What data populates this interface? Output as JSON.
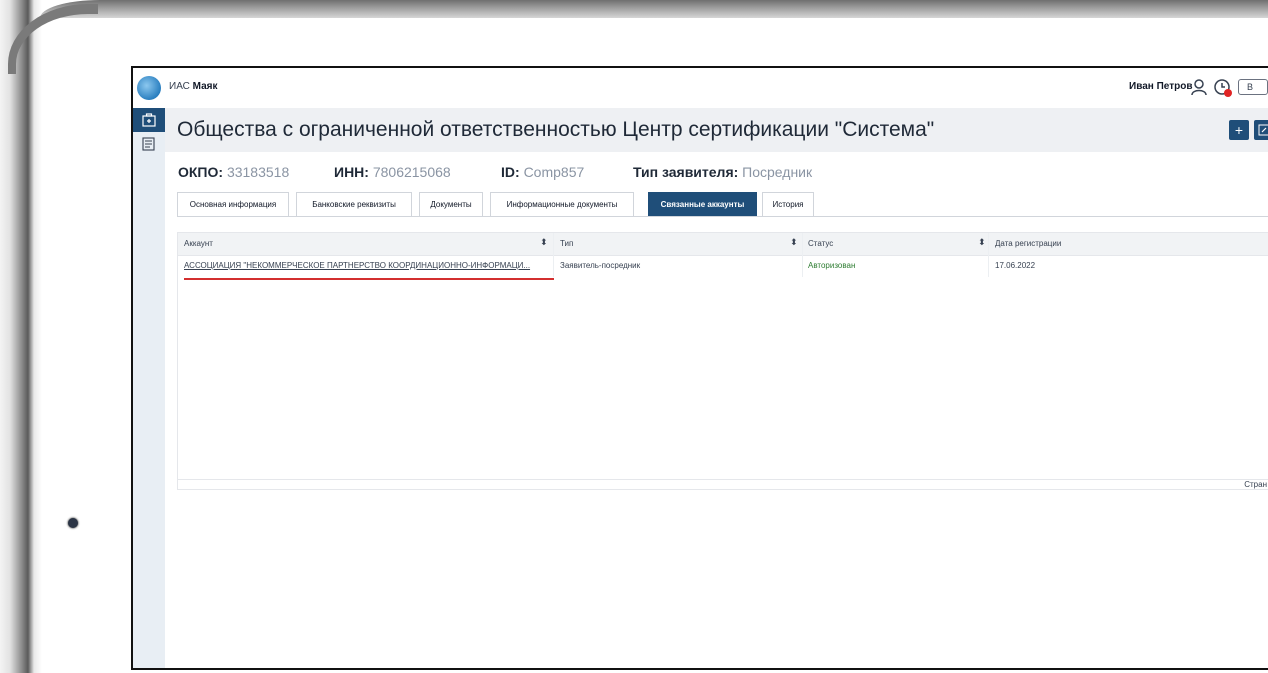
{
  "topbar": {
    "app_prefix": "ИАС",
    "app_name": "Маяк",
    "user_name": "Иван Петров",
    "exit_label": "В"
  },
  "header": {
    "title": "Общества с ограниченной ответственностью Центр сертификации \"Система\"",
    "add_button": "+",
    "edit_icon": "edit-icon"
  },
  "info": {
    "okpo_label": "ОКПО:",
    "okpo_value": "33183518",
    "inn_label": "ИНН:",
    "inn_value": "7806215068",
    "id_label": "ID:",
    "id_value": "Comp857",
    "type_label": "Тип заявителя:",
    "type_value": "Посредник"
  },
  "tabs": [
    {
      "label": "Основная информация"
    },
    {
      "label": "Банковские реквизиты"
    },
    {
      "label": "Документы"
    },
    {
      "label": "Информационные документы"
    },
    {
      "label": "Связанные аккаунты"
    },
    {
      "label": "История"
    }
  ],
  "active_tab": "Связанные аккаунты",
  "table": {
    "columns": [
      "Аккаунт",
      "Тип",
      "Статус",
      "Дата регистрации"
    ],
    "rows": [
      {
        "account": "АССОЦИАЦИЯ \"НЕКОММЕРЧЕСКОЕ ПАРТНЕРСТВО КООРДИНАЦИОННО-ИНФОРМАЦИ...",
        "type": "Заявитель-посредник",
        "status": "Авторизован",
        "date": "17.06.2022"
      }
    ],
    "pager_text": "Стран"
  },
  "colors": {
    "accent": "#1f4e79",
    "status_ok": "#2e7d32",
    "highlight": "#d32f2f"
  }
}
